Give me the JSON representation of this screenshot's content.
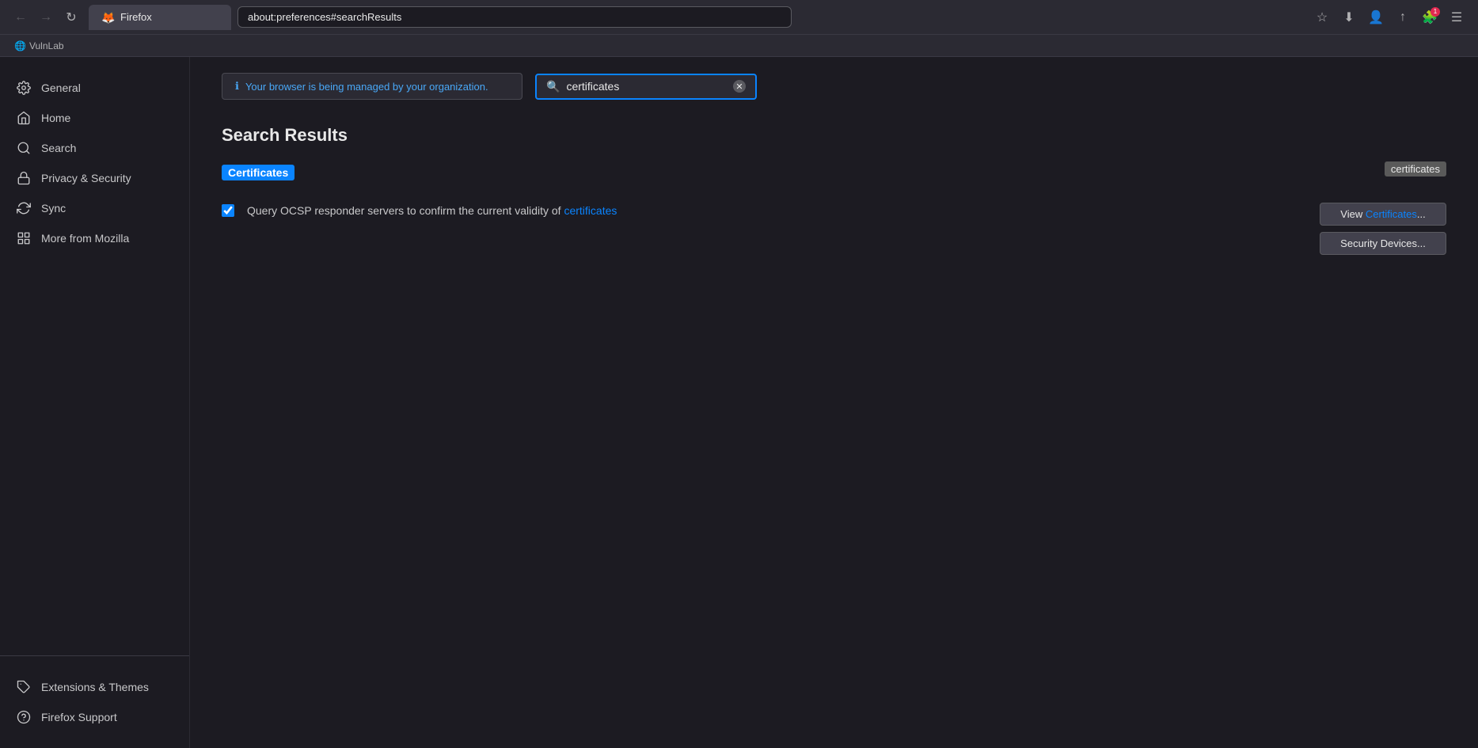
{
  "browser": {
    "nav": {
      "back_label": "←",
      "forward_label": "→",
      "reload_label": "↻",
      "tab_logo": "🦊",
      "tab_title": "Firefox",
      "address": "about:preferences#searchResults",
      "star_label": "☆",
      "save_label": "⬇",
      "account_label": "👤",
      "share_label": "↑",
      "extensions_icon": "🧩",
      "menu_label": "☰"
    },
    "bookmarks_bar": {
      "item": "VulnLab"
    }
  },
  "sidebar": {
    "items": [
      {
        "id": "general",
        "label": "General",
        "icon": "gear"
      },
      {
        "id": "home",
        "label": "Home",
        "icon": "home"
      },
      {
        "id": "search",
        "label": "Search",
        "icon": "search"
      },
      {
        "id": "privacy-security",
        "label": "Privacy & Security",
        "icon": "lock"
      },
      {
        "id": "sync",
        "label": "Sync",
        "icon": "sync"
      },
      {
        "id": "more-from-mozilla",
        "label": "More from Mozilla",
        "icon": "mozilla"
      }
    ],
    "bottom_items": [
      {
        "id": "extensions-themes",
        "label": "Extensions & Themes",
        "icon": "puzzle"
      },
      {
        "id": "firefox-support",
        "label": "Firefox Support",
        "icon": "question"
      }
    ]
  },
  "preferences": {
    "org_notice": "Your browser is being managed by your organization.",
    "search_placeholder": "certificates",
    "search_value": "certificates",
    "page_title": "Search Results",
    "results": {
      "section_title": "Certificates",
      "tooltip_text": "certificates",
      "ocsp_label_prefix": "Query OCSP responder servers to confirm the current validity of ",
      "ocsp_highlight": "certificates",
      "ocsp_checkbox_checked": true,
      "btn_view_prefix": "View ",
      "btn_view_highlight": "Certificates",
      "btn_view_suffix": "...",
      "btn_security_devices": "Security Devices..."
    }
  }
}
